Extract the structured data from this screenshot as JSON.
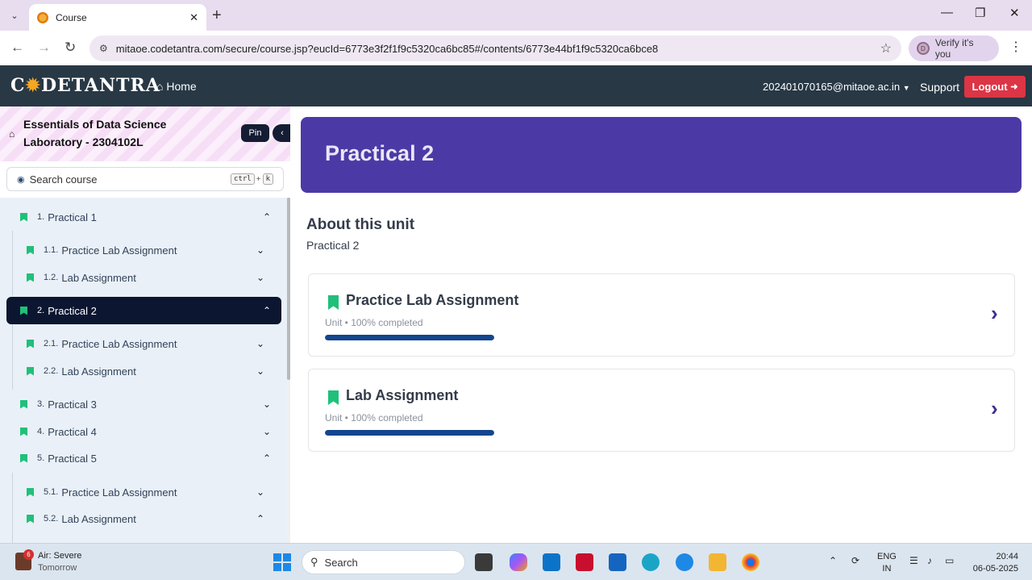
{
  "browser": {
    "tab_title": "Course",
    "url": "mitaoe.codetantra.com/secure/course.jsp?eucId=6773e3f2f1f9c5320ca6bc85#/contents/6773e44bf1f9c5320ca6bce8",
    "verify_label": "Verify it's you",
    "avatar_letter": "D"
  },
  "appbar": {
    "logo_pre": "C",
    "logo_sun": "✹",
    "logo_post": "DETANTRA",
    "home_label": "Home",
    "user_email": "202401070165@mitaoe.ac.in",
    "support_label": "Support",
    "logout_label": "Logout"
  },
  "sidebar": {
    "course_title": "Essentials of Data Science Laboratory - 2304102L",
    "pin_label": "Pin",
    "search_placeholder": "Search course",
    "shortcut_key1": "ctrl",
    "shortcut_plus": "+",
    "shortcut_key2": "k",
    "items": [
      {
        "num": "1.",
        "label": "Practical 1",
        "level": 1,
        "expanded": true,
        "active": false
      },
      {
        "num": "1.1.",
        "label": "Practice Lab Assignment",
        "level": 2,
        "expanded": false,
        "active": false
      },
      {
        "num": "1.2.",
        "label": "Lab Assignment",
        "level": 2,
        "expanded": false,
        "active": false
      },
      {
        "num": "2.",
        "label": "Practical 2",
        "level": 1,
        "expanded": true,
        "active": true
      },
      {
        "num": "2.1.",
        "label": "Practice Lab Assignment",
        "level": 2,
        "expanded": false,
        "active": false
      },
      {
        "num": "2.2.",
        "label": "Lab Assignment",
        "level": 2,
        "expanded": false,
        "active": false
      },
      {
        "num": "3.",
        "label": "Practical 3",
        "level": 1,
        "expanded": false,
        "active": false
      },
      {
        "num": "4.",
        "label": "Practical 4",
        "level": 1,
        "expanded": false,
        "active": false
      },
      {
        "num": "5.",
        "label": "Practical 5",
        "level": 1,
        "expanded": true,
        "active": false
      },
      {
        "num": "5.1.",
        "label": "Practice Lab Assignment",
        "level": 2,
        "expanded": false,
        "active": false
      },
      {
        "num": "5.2.",
        "label": "Lab Assignment",
        "level": 2,
        "expanded": true,
        "active": false
      }
    ]
  },
  "main": {
    "banner_title": "Practical 2",
    "about_heading": "About this unit",
    "about_text": "Practical 2",
    "cards": [
      {
        "title": "Practice Lab Assignment",
        "meta": "Unit • 100% completed",
        "progress": 1.0
      },
      {
        "title": "Lab Assignment",
        "meta": "Unit • 100% completed",
        "progress": 1.0
      }
    ]
  },
  "taskbar": {
    "weather_badge": "6",
    "weather_line1": "Air: Severe",
    "weather_line2": "Tomorrow",
    "search_label": "Search",
    "lang_line1": "ENG",
    "lang_line2": "IN",
    "time": "20:44",
    "date": "06-05-2025"
  },
  "colors": {
    "banner": "#4b3aa6",
    "active_item": "#0c1630",
    "progress": "#13468e",
    "logout": "#dc3545",
    "bookmark": "#20c07a"
  }
}
